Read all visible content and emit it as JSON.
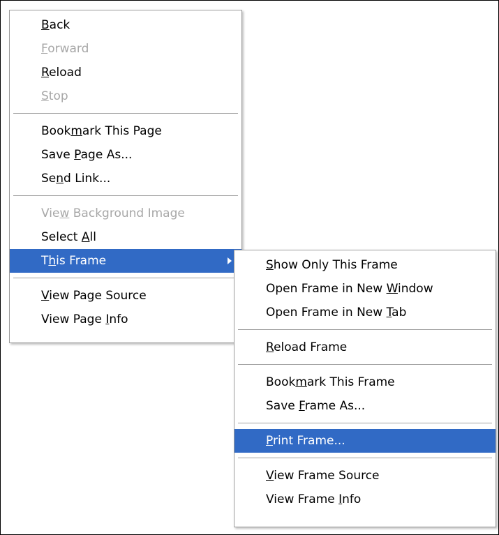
{
  "main_menu": {
    "items": [
      {
        "pre": "",
        "acc": "B",
        "post": "ack"
      },
      {
        "pre": "",
        "acc": "F",
        "post": "orward"
      },
      {
        "pre": "",
        "acc": "R",
        "post": "eload"
      },
      {
        "pre": "",
        "acc": "S",
        "post": "top"
      },
      {
        "pre": "Book",
        "acc": "m",
        "post": "ark This Page"
      },
      {
        "pre": "Save ",
        "acc": "P",
        "post": "age As..."
      },
      {
        "pre": "Se",
        "acc": "n",
        "post": "d Link..."
      },
      {
        "pre": "Vie",
        "acc": "w",
        "post": " Background Image"
      },
      {
        "pre": "Select ",
        "acc": "A",
        "post": "ll"
      },
      {
        "pre": "T",
        "acc": "h",
        "post": "is Frame"
      },
      {
        "pre": "",
        "acc": "V",
        "post": "iew Page Source"
      },
      {
        "pre": "View Page ",
        "acc": "I",
        "post": "nfo"
      }
    ]
  },
  "sub_menu": {
    "items": [
      {
        "pre": "",
        "acc": "S",
        "post": "how Only This Frame"
      },
      {
        "pre": "Open Frame in New ",
        "acc": "W",
        "post": "indow"
      },
      {
        "pre": "Open Frame in New ",
        "acc": "T",
        "post": "ab"
      },
      {
        "pre": "",
        "acc": "R",
        "post": "eload Frame"
      },
      {
        "pre": "Book",
        "acc": "m",
        "post": "ark This Frame"
      },
      {
        "pre": "Save ",
        "acc": "F",
        "post": "rame As..."
      },
      {
        "pre": "",
        "acc": "P",
        "post": "rint Frame..."
      },
      {
        "pre": "",
        "acc": "V",
        "post": "iew Frame Source"
      },
      {
        "pre": "View Frame ",
        "acc": "I",
        "post": "nfo"
      }
    ]
  },
  "colors": {
    "highlight": "#316ac5",
    "disabled_text": "#a7a7a7",
    "menu_border": "#9d9d9d"
  }
}
